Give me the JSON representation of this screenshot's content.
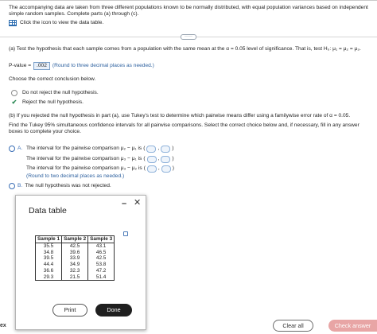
{
  "question": {
    "intro": "The accompanying data are taken from three different populations known to be normally distributed, with equal population variances based on independent simple random samples. Complete parts (a) through (c).",
    "icon_link_label": "Click the icon to view the data table.",
    "more_label": "·····"
  },
  "part_a": {
    "prompt": "(a) Test the hypothesis that each sample comes from a population with the same mean at the α = 0.05 level of significance. That is, test H₀: μ₁ = μ₂ = μ₃.",
    "pvalue_label": "P-value =",
    "pvalue_answer": ".002",
    "pvalue_hint": "(Round to three decimal places as needed.)",
    "choose_label": "Choose the correct conclusion below.",
    "options": [
      {
        "label": "Do not reject the null hypothesis.",
        "selected": false
      },
      {
        "label": "Reject the null hypothesis.",
        "selected": true
      }
    ]
  },
  "part_b": {
    "prompt": "(b) If you rejected the null hypothesis in part (a), use Tukey's test to determine which pairwise means differ using a familywise error rate of α = 0.05.",
    "find": "Find the Tukey 95% simultaneous confidence intervals for all pairwise comparisons. Select the correct choice below and, if necessary, fill in any answer boxes to complete your choice.",
    "option_a_letter": "A.",
    "intervals": [
      {
        "text": "The interval for the pairwise comparison μ₂ − μ₁ is",
        "sep": ","
      },
      {
        "text": "The interval for the pairwise comparison μ₃ − μ₁ is",
        "sep": ","
      },
      {
        "text": "The interval for the pairwise comparison μ₃ − μ₂ is",
        "sep": ","
      }
    ],
    "round_hint": "(Round to two decimal places as needed.)",
    "option_b_letter": "B.",
    "option_b_text": "The null hypothesis was not rejected."
  },
  "dialog": {
    "title": "Data table",
    "minimize": "–",
    "close": "✕",
    "headers": [
      "Sample 1",
      "Sample 2",
      "Sample 3"
    ],
    "rows": [
      [
        "35.5",
        "42.5",
        "43.1"
      ],
      [
        "34.8",
        "39.6",
        "46.5"
      ],
      [
        "39.5",
        "33.9",
        "42.5"
      ],
      [
        "44.4",
        "34.9",
        "53.8"
      ],
      [
        "36.6",
        "32.3",
        "47.2"
      ],
      [
        "29.3",
        "21.5",
        "51.4"
      ]
    ],
    "print_label": "Print",
    "done_label": "Done"
  },
  "footer": {
    "ex_label": "ex",
    "clear_all": "Clear all",
    "check_answer": "Check answer"
  }
}
